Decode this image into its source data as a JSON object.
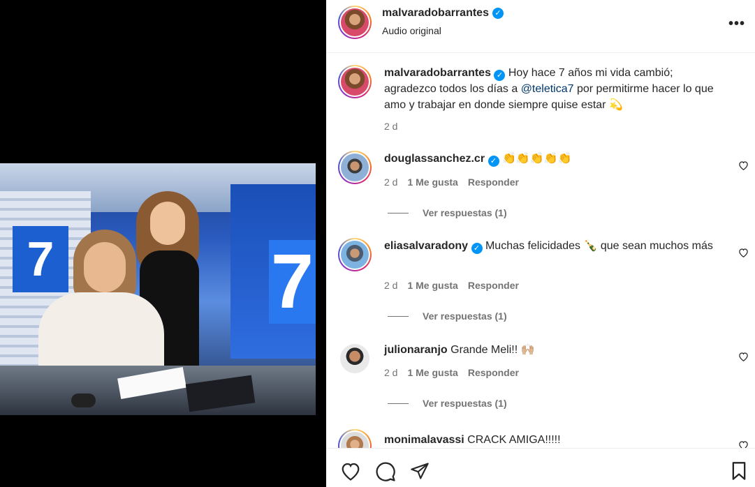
{
  "header": {
    "username": "malvaradobarrantes",
    "subtitle": "Audio original",
    "more_label": "•••"
  },
  "caption": {
    "username": "malvaradobarrantes",
    "text_before": " Hoy hace 7 años mi vida cambió; agradezco todos los días a ",
    "mention": "@teletica7",
    "text_after": " por permitirme hacer lo que amo y trabajar en donde siempre quise estar 💫",
    "time": "2 d"
  },
  "comments": [
    {
      "username": "douglassanchez.cr",
      "verified": true,
      "text": " 👏👏👏👏👏",
      "time": "2 d",
      "likes": "1 Me gusta",
      "reply": "Responder",
      "view_replies": "Ver respuestas (1)"
    },
    {
      "username": "eliasalvaradony",
      "verified": true,
      "text": " Muchas felicidades 🍾 que sean muchos más",
      "time": "2 d",
      "likes": "1 Me gusta",
      "reply": "Responder",
      "view_replies": "Ver respuestas (1)"
    },
    {
      "username": "julionaranjo",
      "verified": false,
      "text": " Grande Meli!! 🙌🏼",
      "time": "2 d",
      "likes": "1 Me gusta",
      "reply": "Responder",
      "view_replies": "Ver respuestas (1)"
    },
    {
      "username": "monimalavassi",
      "verified": false,
      "text": " CRACK AMIGA!!!!!"
    }
  ],
  "verified_mark": "✓",
  "colors": {
    "verified": "#0095f6",
    "mention": "#00376b",
    "meta": "#737373",
    "text": "#262626"
  },
  "icons": [
    "heart-icon",
    "comment-icon",
    "share-icon",
    "bookmark-icon",
    "more-icon",
    "verified-icon"
  ]
}
